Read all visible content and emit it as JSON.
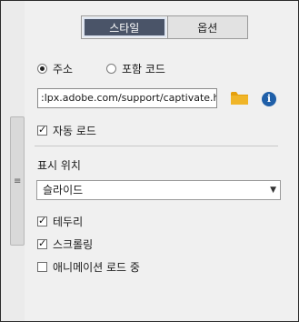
{
  "tabs": [
    {
      "label": "스타일",
      "active": true
    },
    {
      "label": "옵션",
      "active": false
    }
  ],
  "source": {
    "options": [
      {
        "label": "주소",
        "selected": true
      },
      {
        "label": "포함 코드",
        "selected": false
      }
    ],
    "url_value": ":lpx.adobe.com/support/captivate.html",
    "folder_icon": "folder-icon",
    "info_icon": "info-icon",
    "info_glyph": "i"
  },
  "auto_load": {
    "label": "자동 로드",
    "checked": true
  },
  "display": {
    "section_label": "표시 위치",
    "dropdown_value": "슬라이드",
    "dropdown_arrow": "▼"
  },
  "checkboxes": [
    {
      "label": "테두리",
      "checked": true
    },
    {
      "label": "스크롤링",
      "checked": true
    },
    {
      "label": "애니메이션 로드 중",
      "checked": false
    }
  ],
  "splitter_grip": "≡",
  "colors": {
    "active_tab": "#4a5468",
    "folder": "#e5a00d",
    "info": "#1f5fa8"
  }
}
